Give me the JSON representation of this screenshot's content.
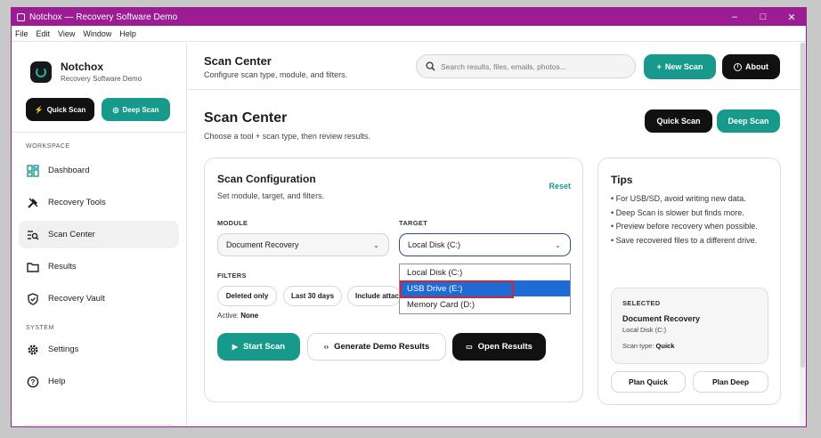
{
  "window": {
    "title": "Notchox — Recovery Software Demo",
    "minimize": "–",
    "maximize": "□",
    "close": "✕"
  },
  "menu": [
    "File",
    "Edit",
    "View",
    "Window",
    "Help"
  ],
  "sidebar": {
    "brand_name": "Notchox",
    "brand_sub": "Recovery Software Demo",
    "quick_scan": "Quick Scan",
    "deep_scan": "Deep Scan",
    "section_workspace": "WORKSPACE",
    "section_system": "SYSTEM",
    "workspace_items": [
      {
        "label": "Dashboard",
        "icon": "dashboard-icon"
      },
      {
        "label": "Recovery Tools",
        "icon": "tools-icon"
      },
      {
        "label": "Scan Center",
        "icon": "scan-icon",
        "active": true
      },
      {
        "label": "Results",
        "icon": "folder-icon"
      },
      {
        "label": "Recovery Vault",
        "icon": "shield-icon"
      }
    ],
    "system_items": [
      {
        "label": "Settings",
        "icon": "gear-icon"
      },
      {
        "label": "Help",
        "icon": "help-icon"
      }
    ]
  },
  "topbar": {
    "title": "Scan Center",
    "subtitle": "Configure scan type, module, and filters.",
    "search_placeholder": "Search results, files, emails, photos...",
    "new_scan": "New Scan",
    "about": "About"
  },
  "page": {
    "title": "Scan Center",
    "subtitle": "Choose a tool + scan type, then review results.",
    "quick_scan": "Quick Scan",
    "deep_scan": "Deep Scan"
  },
  "config": {
    "title": "Scan Configuration",
    "subtitle": "Set module, target, and filters.",
    "reset": "Reset",
    "module_label": "MODULE",
    "module_value": "Document Recovery",
    "target_label": "TARGET",
    "target_value": "Local Disk (C:)",
    "target_options": [
      "Local Disk (C:)",
      "USB Drive (E:)",
      "Memory Card (D:)"
    ],
    "target_highlighted": "USB Drive (E:)",
    "filters_label": "FILTERS",
    "filters": [
      "Deleted only",
      "Last 30 days",
      "Include attachments"
    ],
    "active_prefix": "Active:",
    "active_value": "None",
    "start_scan": "Start Scan",
    "generate_demo": "Generate Demo Results",
    "open_results": "Open Results"
  },
  "tips": {
    "title": "Tips",
    "items": [
      "• For USB/SD, avoid writing new data.",
      "• Deep Scan is slower but finds more.",
      "• Preview before recovery when possible.",
      "• Save recovered files to a different drive."
    ],
    "selected_label": "SELECTED",
    "selected_module": "Document Recovery",
    "selected_target": "Local Disk (C:)",
    "scan_type_prefix": "Scan type:",
    "scan_type_value": "Quick",
    "plan_quick": "Plan Quick",
    "plan_deep": "Plan Deep"
  },
  "colors": {
    "accent": "#179a8c",
    "titlebar": "#9b1c93",
    "dark": "#111111",
    "dropdown_selected": "#1f6bd6",
    "highlight_box": "#d9232f"
  }
}
